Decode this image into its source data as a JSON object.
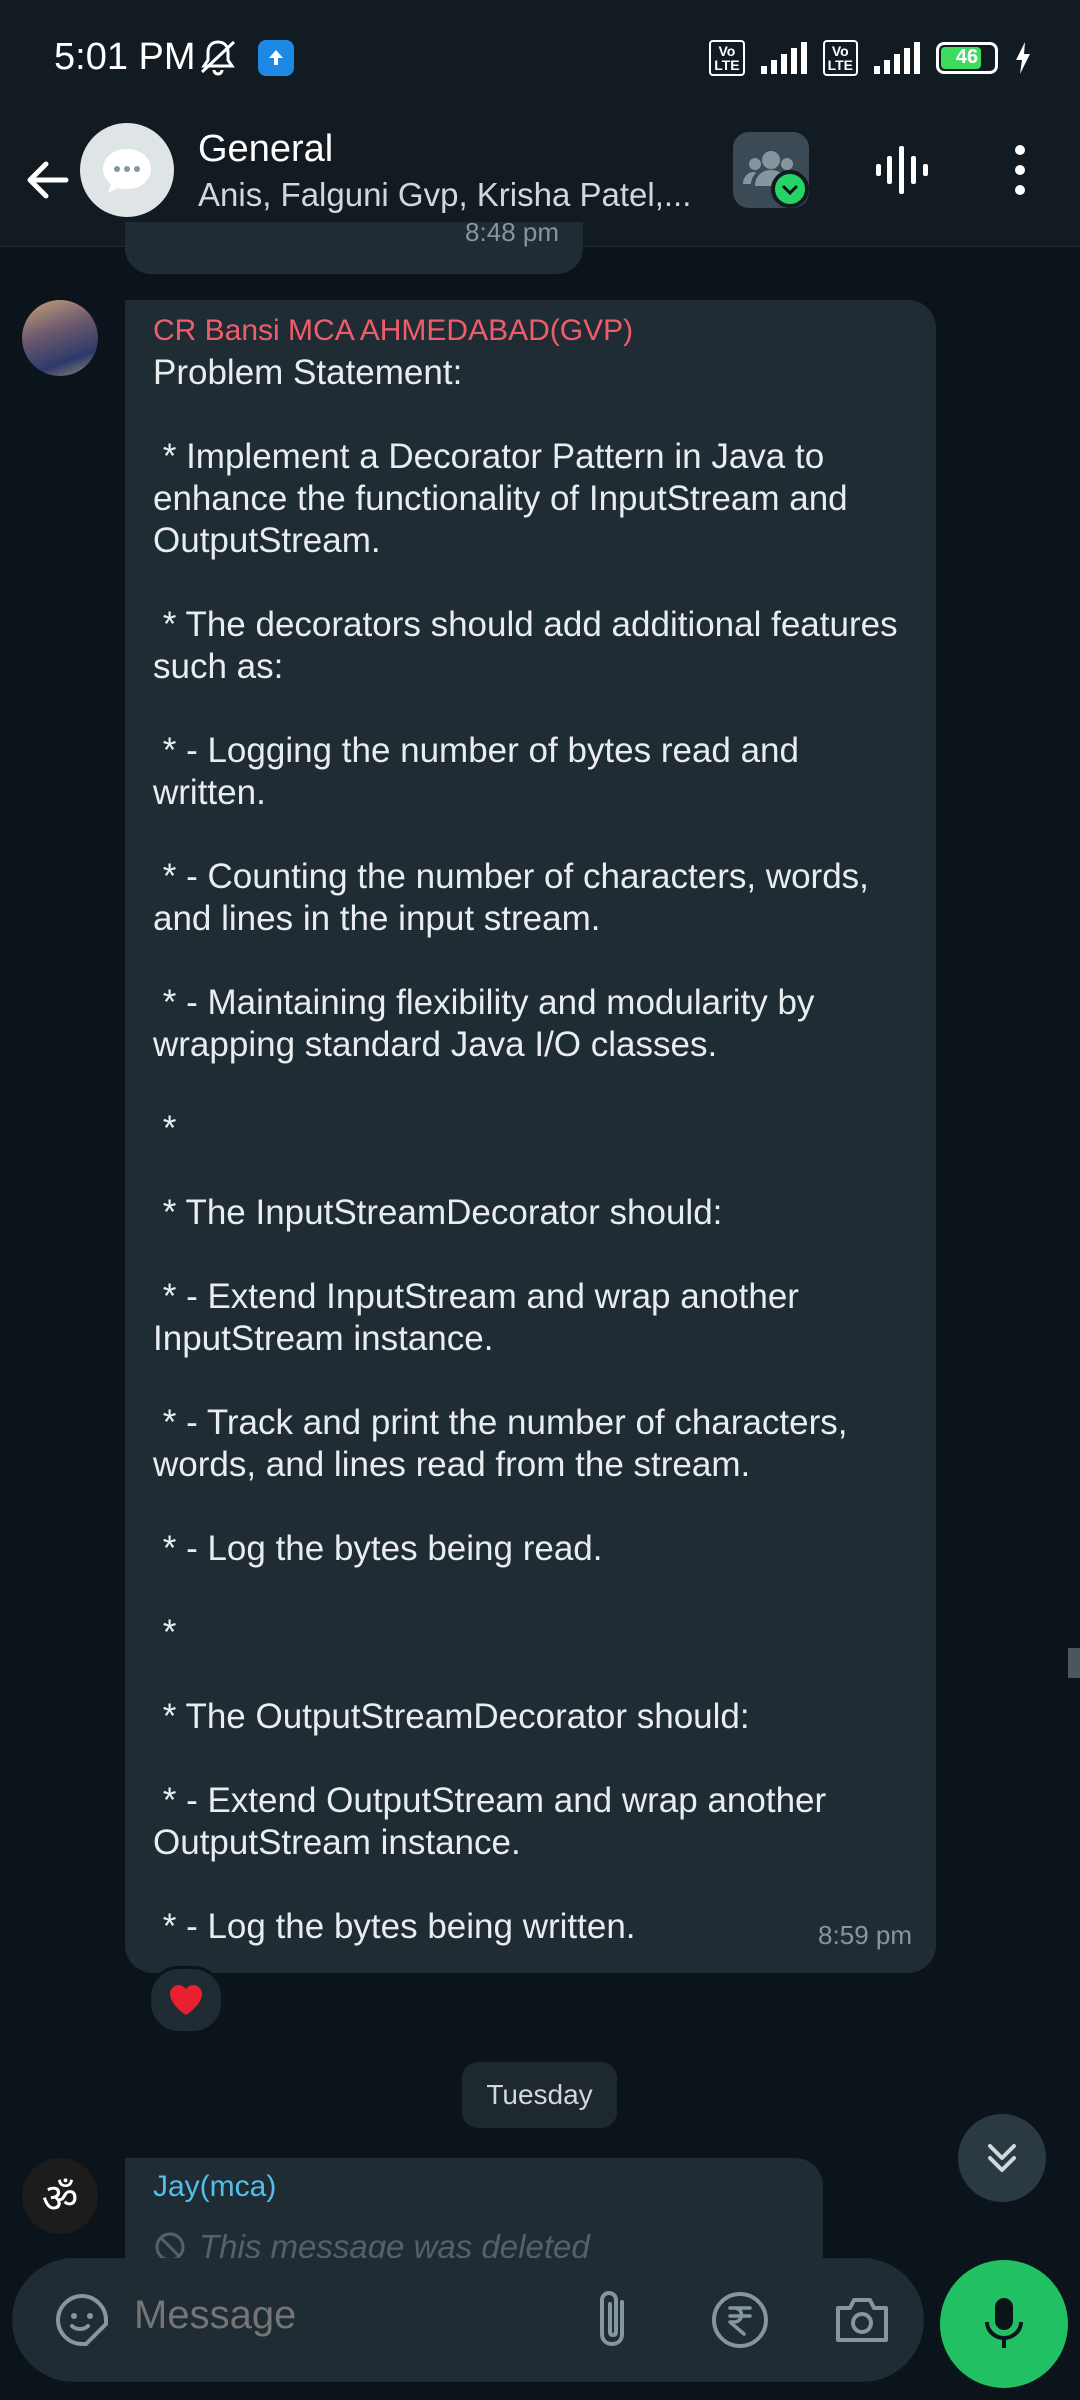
{
  "status_bar": {
    "time": "5:01 PM",
    "icons": [
      "mute-icon",
      "upload-icon",
      "volte-icon",
      "signal-icon",
      "volte-icon",
      "signal-icon",
      "battery-icon",
      "charging-icon"
    ],
    "volte_label": "Vo\nLTE",
    "battery": "46"
  },
  "header": {
    "title": "General",
    "members": "Anis, Falguni Gvp, Krisha Patel,..."
  },
  "previous_message": {
    "time": "8:48 pm"
  },
  "message": {
    "sender": "CR Bansi MCA AHMEDABAD(GVP)",
    "sender_color": "#f15c6d",
    "text": "Problem Statement:\n\n * Implement a Decorator Pattern in Java to enhance the functionality of InputStream and OutputStream.\n\n * The decorators should add additional features such as:\n\n * - Logging the number of bytes read and written.\n\n * - Counting the number of characters, words, and lines in the input stream.\n\n * - Maintaining flexibility and modularity by wrapping standard Java I/O classes.\n\n *\n\n * The InputStreamDecorator should:\n\n * - Extend InputStream and wrap another InputStream instance.\n\n * - Track and print the number of characters, words, and lines read from the stream.\n\n * - Log the bytes being read.\n\n *\n\n * The OutputStreamDecorator should:\n\n * - Extend OutputStream and wrap another OutputStream instance.\n\n * - Log the bytes being written.",
    "time": "8:59 pm",
    "reaction": "❤️"
  },
  "date_divider": "Tuesday",
  "next_message": {
    "sender": "Jay(mca)",
    "sender_color": "#53bdeb",
    "deleted_text": "This message was deleted"
  },
  "composer": {
    "placeholder": "Message"
  },
  "colors": {
    "background": "#0b141a",
    "bubble": "#202c33",
    "accent": "#21c063"
  }
}
